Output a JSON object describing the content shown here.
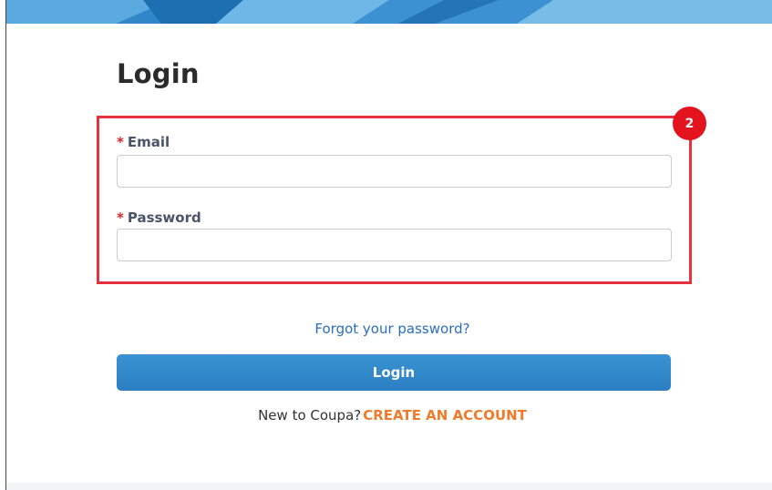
{
  "page": {
    "title": "Login"
  },
  "annotation": {
    "step_number": "2",
    "highlight_color": "#e8313f"
  },
  "form": {
    "email": {
      "label": "Email",
      "required_marker": "*",
      "value": ""
    },
    "password": {
      "label": "Password",
      "required_marker": "*",
      "value": ""
    }
  },
  "links": {
    "forgot_password": "Forgot your password?"
  },
  "actions": {
    "login_label": "Login"
  },
  "signup": {
    "prompt": "New to Coupa?",
    "create_account": "CREATE AN ACCOUNT"
  },
  "colors": {
    "primary_button": "#2a7fc2",
    "link_blue": "#2a6ebd",
    "accent_orange": "#ef7b2b",
    "required_red": "#d8232a"
  }
}
